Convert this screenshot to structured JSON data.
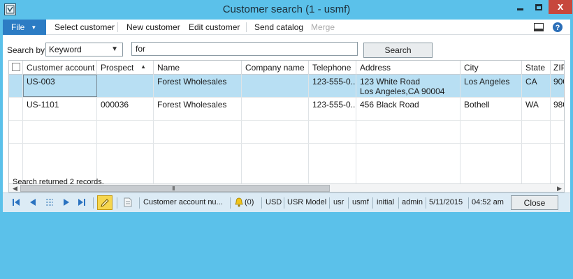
{
  "window": {
    "title": "Customer search (1 - usmf)",
    "close_glyph": "x"
  },
  "ribbon": {
    "file_label": "File",
    "items": [
      "Select customer",
      "New customer",
      "Edit customer",
      "Send catalog",
      "Merge"
    ],
    "disabled_item": "Merge"
  },
  "search": {
    "label": "Search by:",
    "mode_value": "Keyword",
    "query_value": "for",
    "button_label": "Search"
  },
  "grid": {
    "columns": [
      "Customer account",
      "Prospect",
      "Name",
      "Company name",
      "Telephone",
      "Address",
      "City",
      "State",
      "ZIP"
    ],
    "sort_column": "Prospect",
    "sort_direction": "ascending",
    "rows": [
      {
        "account": "US-003",
        "prospect": "",
        "name": "Forest Wholesales",
        "company": "",
        "telephone": "123-555-0...",
        "address_line1": "123 White Road",
        "address_line2": "Los Angeles,CA 90004",
        "city": "Los Angeles",
        "state": "CA",
        "zip": "900",
        "selected": true
      },
      {
        "account": "US-1101",
        "prospect": "000036",
        "name": "Forest Wholesales",
        "company": "",
        "telephone": "123-555-0...",
        "address_line1": "456 Black Road",
        "address_line2": "",
        "city": "Bothell",
        "state": "WA",
        "zip": "980",
        "selected": false
      }
    ],
    "scroll_grip": "III"
  },
  "status_message": "Search returned 2 records.",
  "statusbar": {
    "field": "Customer account nu...",
    "alerts": "(0)",
    "currency": "USD",
    "model": "USR Model",
    "layer": "usr",
    "company": "usmf",
    "partition": "initial",
    "user": "admin",
    "date": "5/11/2015",
    "time": "04:52 am",
    "close_label": "Close"
  },
  "colors": {
    "frame": "#5bc1ea",
    "file_button": "#2c7cc4",
    "selected_row": "#b8dff3",
    "close_button": "#c7473c",
    "edit_button": "#f6d64e"
  },
  "icons": [
    "app-icon",
    "minimize-icon",
    "maximize-icon",
    "close-icon",
    "layout-icon",
    "help-icon",
    "first-record-icon",
    "previous-record-icon",
    "grid-view-icon",
    "next-record-icon",
    "last-record-icon",
    "edit-pencil-icon",
    "document-icon",
    "bell-icon"
  ]
}
